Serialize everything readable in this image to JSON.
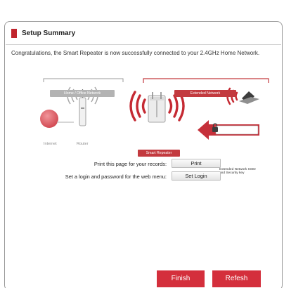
{
  "header": {
    "title": "Setup Summary"
  },
  "message": "Congratulations, the Smart Repeater is now successfully connected to your 2.4GHz Home Network.",
  "diagram": {
    "home_tag": "Home / Office Network",
    "extended_tag": "Extended Network",
    "internet_label": "Internet",
    "router_label": "Router",
    "repeater_label": "Smart Repeater",
    "callout_line1": "Extended Network SSID",
    "callout_line2": "and Security key"
  },
  "actions": {
    "print_text": "Print this page for your records:",
    "print_label": "Print",
    "login_text": "Set a login and password for the web menu:",
    "login_label": "Set Login"
  },
  "footer": {
    "finish_label": "Finish",
    "refresh_label": "Refesh"
  },
  "colors": {
    "accent": "#c0252d",
    "button_red": "#d42f3c",
    "gray_tag": "#b3b3b3"
  }
}
